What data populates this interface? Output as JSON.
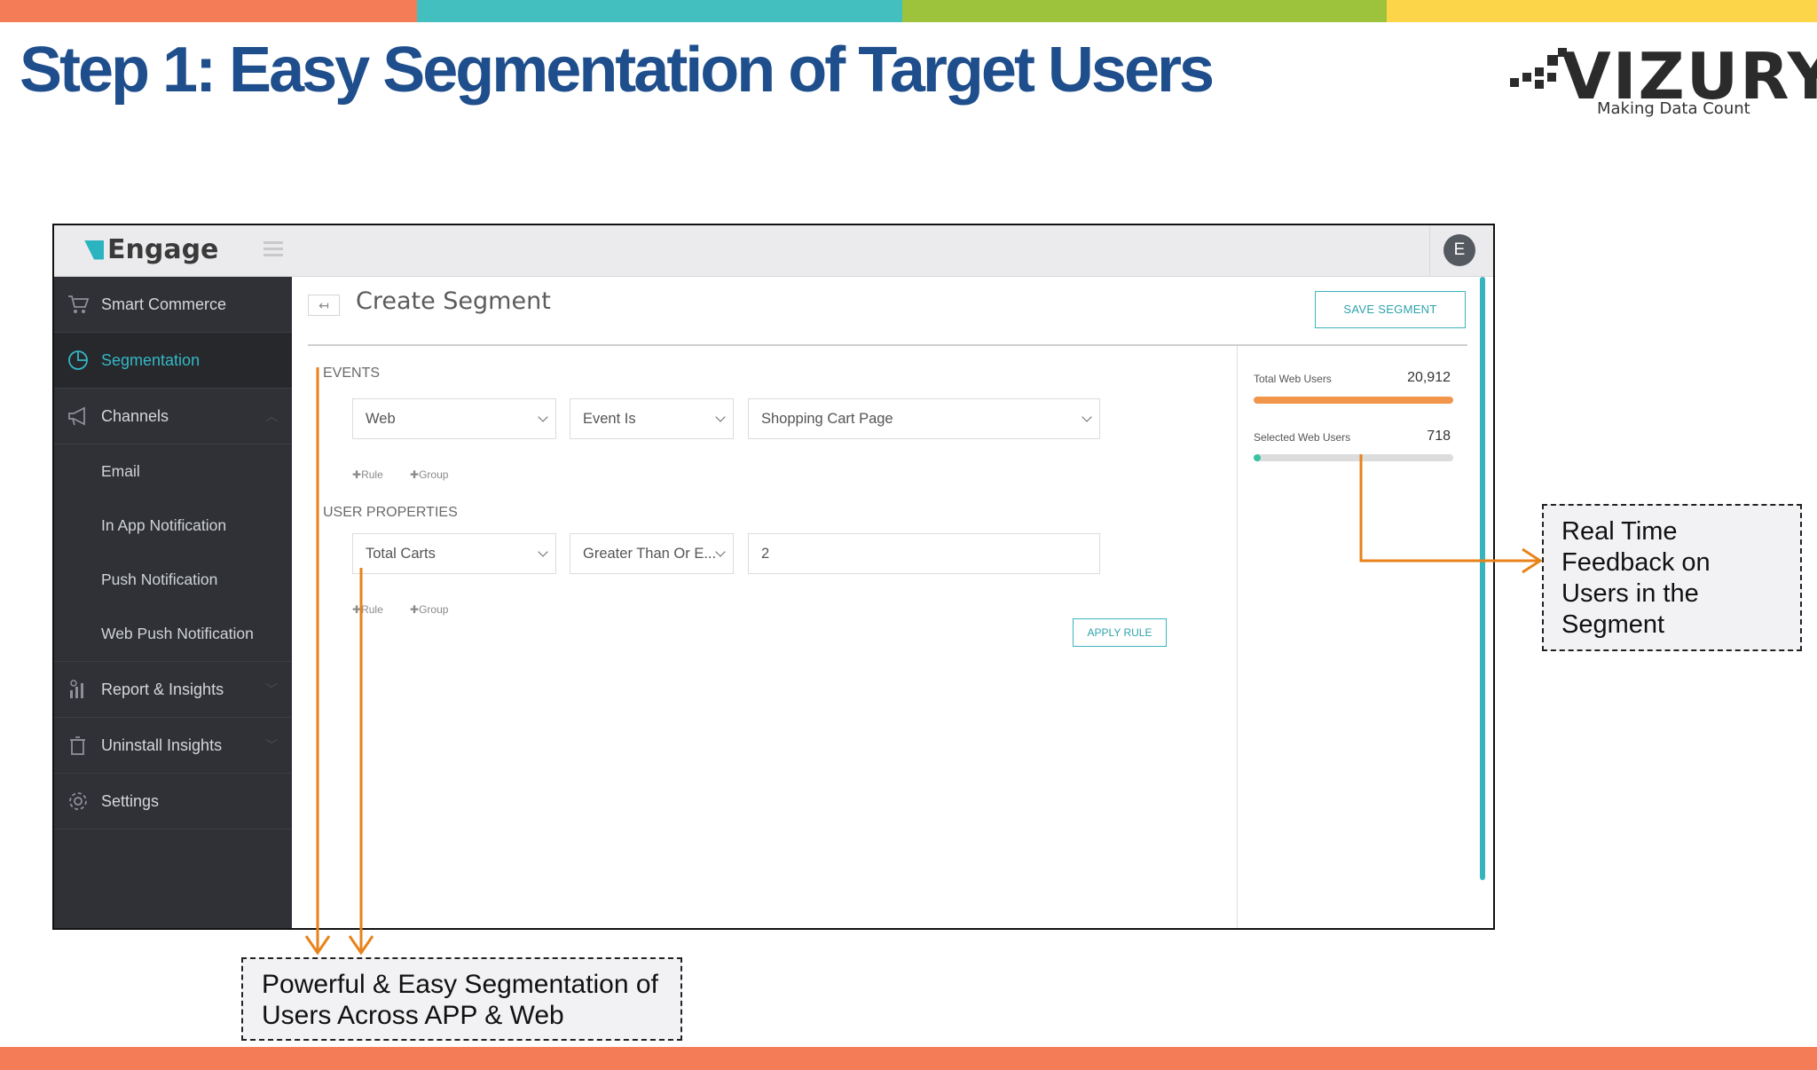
{
  "slide": {
    "title": "Step 1: Easy Segmentation of Target Users",
    "colors": {
      "title": "#1f4e8c",
      "accent_orange": "#e8821a",
      "top_bar": [
        "#f47c57",
        "#44bfc0",
        "#9dc23b",
        "#fdd548"
      ],
      "bottom_bar": "#f47c57"
    }
  },
  "logo": {
    "wordmark": "VIZURY",
    "tagline": "Making Data Count"
  },
  "app": {
    "brand": "Engage",
    "avatar_initial": "E",
    "sidebar": [
      {
        "label": "Smart Commerce",
        "icon": "cart-icon"
      },
      {
        "label": "Segmentation",
        "icon": "pie-chart-icon",
        "active": true
      },
      {
        "label": "Channels",
        "icon": "megaphone-icon",
        "children": [
          "Email",
          "In App Notification",
          "Push Notification",
          "Web Push Notification"
        ]
      },
      {
        "label": "Report & Insights",
        "icon": "report-icon"
      },
      {
        "label": "Uninstall Insights",
        "icon": "trash-icon"
      },
      {
        "label": "Settings",
        "icon": "gear-icon"
      }
    ],
    "page_title": "Create Segment",
    "save_button": "SAVE SEGMENT",
    "events": {
      "label": "EVENTS",
      "platform": "Web",
      "condition": "Event Is",
      "event": "Shopping Cart Page",
      "add_rule": "Rule",
      "add_group": "Group"
    },
    "user_properties": {
      "label": "USER PROPERTIES",
      "property": "Total Carts",
      "operator": "Greater Than Or E...",
      "value": "2",
      "add_rule": "Rule",
      "add_group": "Group"
    },
    "apply_button": "APPLY RULE",
    "stats": {
      "total_label": "Total Web Users",
      "total_value": "20,912",
      "total_fill": 1.0,
      "total_color": "#f0954a",
      "selected_label": "Selected Web Users",
      "selected_value": "718",
      "selected_fill": 0.034,
      "selected_color": "#35c3a2"
    }
  },
  "callouts": {
    "right": [
      "Real Time",
      "Feedback on",
      "Users in the",
      "Segment"
    ],
    "bottom": [
      "Powerful & Easy Segmentation of",
      "Users Across APP & Web"
    ]
  }
}
